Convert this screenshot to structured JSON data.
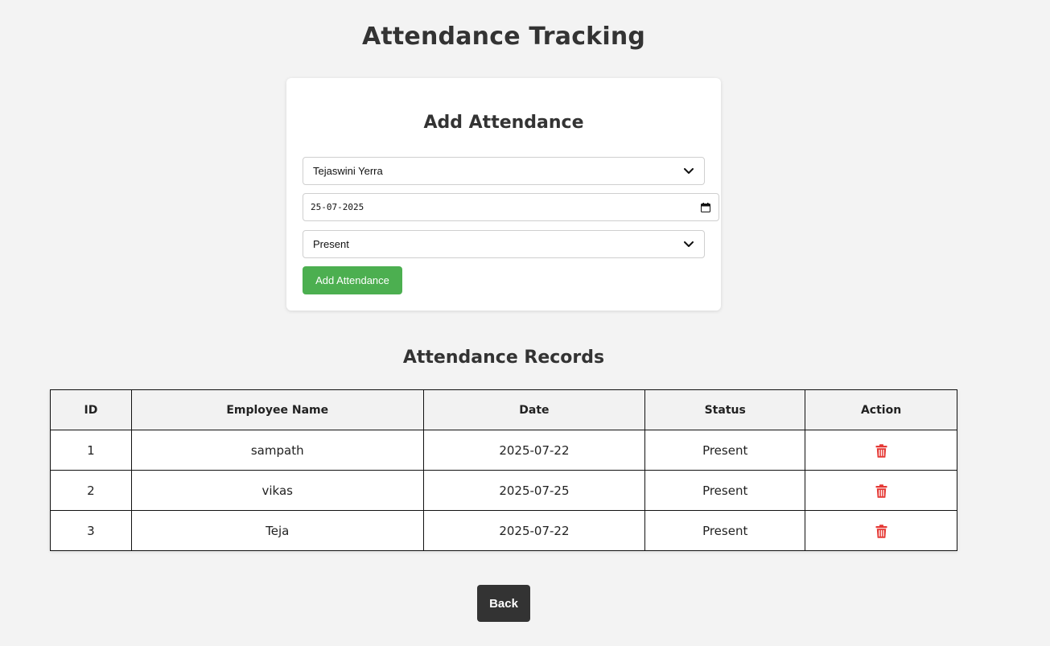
{
  "page": {
    "title": "Attendance Tracking"
  },
  "form": {
    "title": "Add Attendance",
    "employee_select": {
      "value": "Tejaswini Yerra",
      "icon": "chevron-down-icon"
    },
    "date_input": {
      "value": "25-07-2025",
      "icon": "calendar-icon"
    },
    "status_select": {
      "value": "Present",
      "icon": "chevron-down-icon"
    },
    "submit_label": "Add Attendance",
    "colors": {
      "submit_bg": "#4caf50"
    }
  },
  "records": {
    "title": "Attendance Records",
    "headers": [
      "ID",
      "Employee Name",
      "Date",
      "Status",
      "Action"
    ],
    "rows": [
      {
        "id": "1",
        "name": "sampath",
        "date": "2025-07-22",
        "status": "Present",
        "action_icon": "trash-icon"
      },
      {
        "id": "2",
        "name": "vikas",
        "date": "2025-07-25",
        "status": "Present",
        "action_icon": "trash-icon"
      },
      {
        "id": "3",
        "name": "Teja",
        "date": "2025-07-22",
        "status": "Present",
        "action_icon": "trash-icon"
      }
    ],
    "colors": {
      "delete_icon": "#e53935"
    }
  },
  "footer": {
    "back_label": "Back",
    "colors": {
      "back_bg": "#333333"
    }
  }
}
